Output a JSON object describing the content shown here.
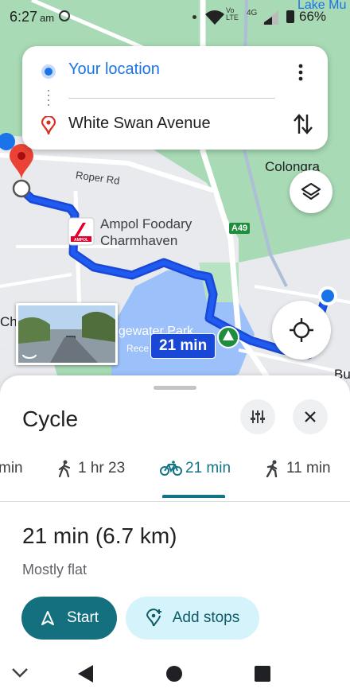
{
  "status": {
    "time": "6:27",
    "ampm": "am",
    "network": "4G",
    "network_sub": "Vo\nLTE",
    "battery": "66%"
  },
  "directions": {
    "origin": "Your location",
    "destination": "White Swan Avenue"
  },
  "map": {
    "labels": {
      "corner_top_right": "Lake Mu",
      "colongra": "Colongra",
      "roper_rd": "Roper Rd",
      "poi_name_line1": "Ampol Foodary",
      "poi_name_line2": "Charmhaven",
      "highway": "A49",
      "park": "dgewater Park",
      "park_sub": "Rece",
      "left_edge": "Ch",
      "right_edge": "Bu",
      "poi_brand": "AMPOL"
    },
    "route_duration_badge": "21 min"
  },
  "sheet": {
    "mode_title": "Cycle",
    "modes": [
      {
        "label": "min",
        "icon": "car-icon"
      },
      {
        "label": "1 hr 23",
        "icon": "walk-icon"
      },
      {
        "label": "21 min",
        "icon": "bike-icon",
        "active": true
      },
      {
        "label": "11 min",
        "icon": "run-icon"
      }
    ],
    "summary": "21 min (6.7 km)",
    "terrain": "Mostly flat",
    "start_label": "Start",
    "add_stops_label": "Add stops"
  },
  "colors": {
    "accent_teal": "#137387",
    "route_blue": "#1a48d6",
    "location_blue": "#1a73e8",
    "map_green": "#a8dab5",
    "water": "#9cc0f9"
  }
}
